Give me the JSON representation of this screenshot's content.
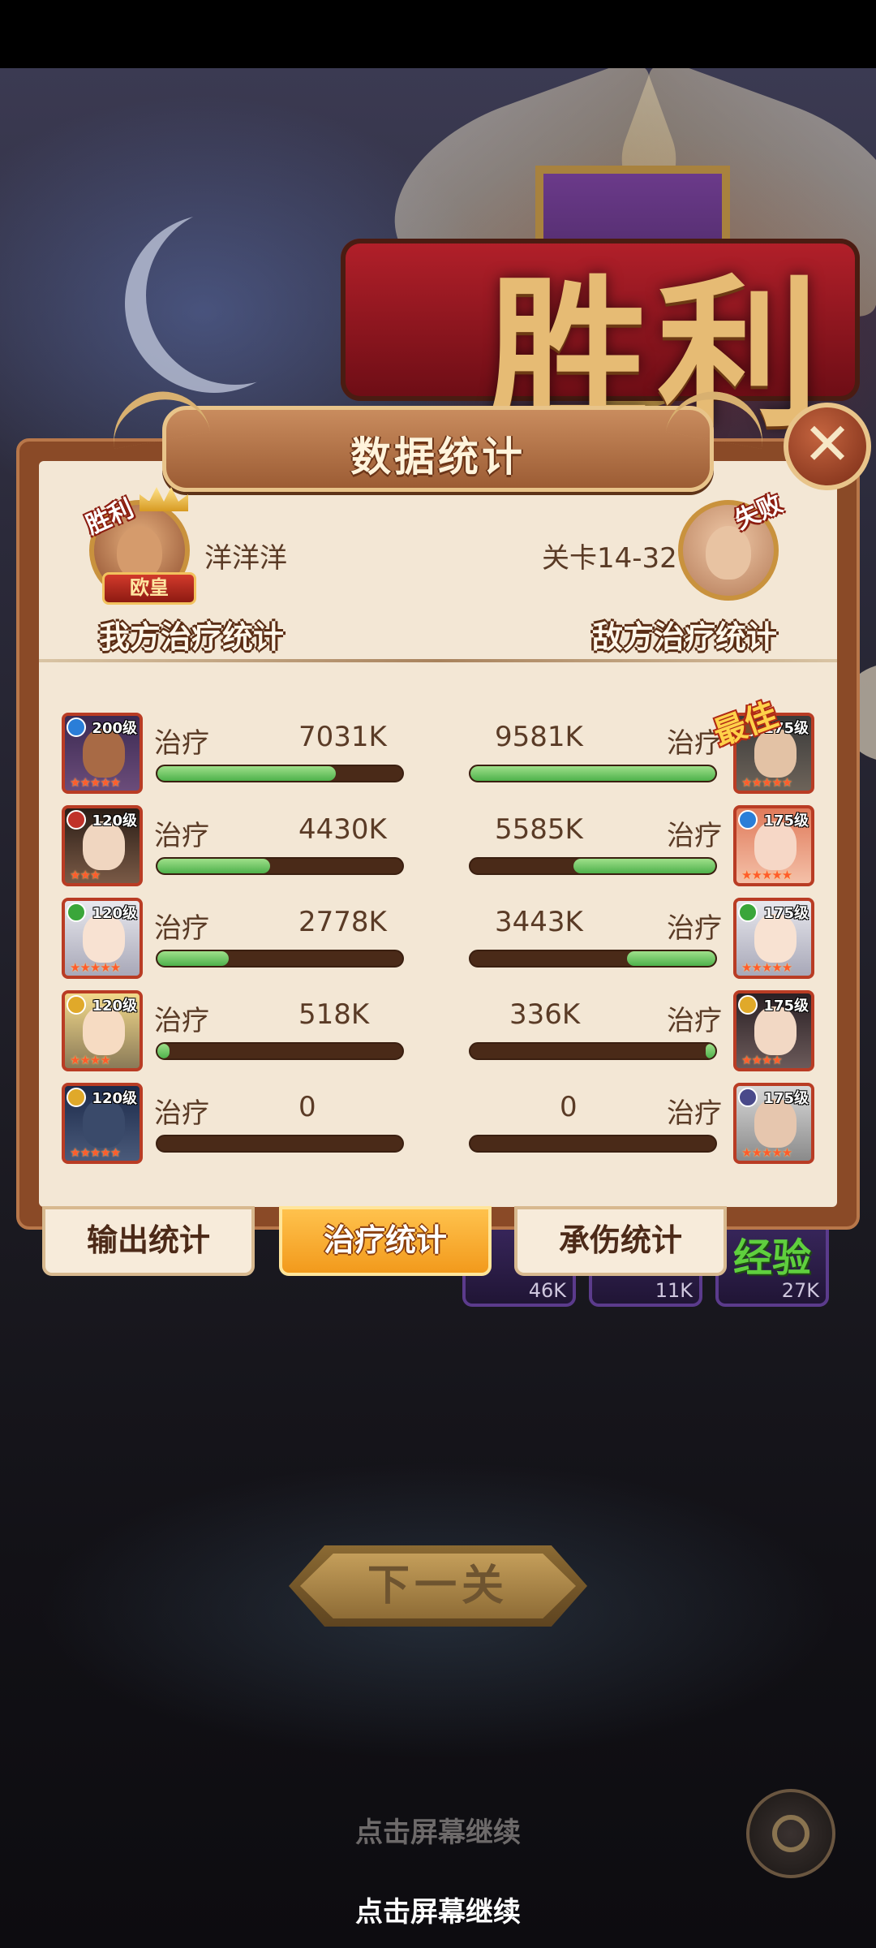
{
  "screen": {
    "victory_text": "胜利",
    "panel_title": "数据统计",
    "close_label": "✕"
  },
  "header": {
    "player": {
      "badge": "胜利",
      "rank": "欧皇",
      "name": "洋洋洋"
    },
    "enemy": {
      "badge": "失败",
      "stage": "关卡14-32"
    },
    "left_section": "我方治疗统计",
    "right_section": "敌方治疗统计",
    "best_tag": "最佳"
  },
  "colors": {
    "bar_fill": "#6cc75a",
    "bar_track": "#4a2a18",
    "panel_bg": "#f3e7d5",
    "frame": "#8a4a27",
    "tab_active": "#f6ae2e"
  },
  "rows": [
    {
      "left": {
        "level": "200级",
        "label": "治疗",
        "value": "7031K",
        "fill": 0.73,
        "stars": "★★★★★",
        "elem_color": "#2a7ed8"
      },
      "right": {
        "level": "175级",
        "label": "治疗",
        "value": "9581K",
        "fill": 1.0,
        "stars": "★★★★★",
        "elem_color": "#7a4c2c"
      }
    },
    {
      "left": {
        "level": "120级",
        "label": "治疗",
        "value": "4430K",
        "fill": 0.46,
        "stars": "★★★",
        "elem_color": "#c0322a"
      },
      "right": {
        "level": "175级",
        "label": "治疗",
        "value": "5585K",
        "fill": 0.58,
        "stars": "★★★★★",
        "elem_color": "#2a7ed8"
      }
    },
    {
      "left": {
        "level": "120级",
        "label": "治疗",
        "value": "2778K",
        "fill": 0.29,
        "stars": "★★★★★",
        "elem_color": "#3aa63a"
      },
      "right": {
        "level": "175级",
        "label": "治疗",
        "value": "3443K",
        "fill": 0.36,
        "stars": "★★★★★",
        "elem_color": "#3aa63a"
      }
    },
    {
      "left": {
        "level": "120级",
        "label": "治疗",
        "value": "518K",
        "fill": 0.05,
        "stars": "★★★★",
        "elem_color": "#e0a92a"
      },
      "right": {
        "level": "175级",
        "label": "治疗",
        "value": "336K",
        "fill": 0.04,
        "stars": "★★★★",
        "elem_color": "#e0a92a"
      }
    },
    {
      "left": {
        "level": "120级",
        "label": "治疗",
        "value": "0",
        "fill": 0,
        "stars": "★★★★★",
        "elem_color": "#e0a92a"
      },
      "right": {
        "level": "175级",
        "label": "治疗",
        "value": "0",
        "fill": 0,
        "stars": "★★★★★",
        "elem_color": "#4a4a8a"
      }
    }
  ],
  "tabs": [
    {
      "label": "输出统计",
      "active": false
    },
    {
      "label": "治疗统计",
      "active": true
    },
    {
      "label": "承伤统计",
      "active": false
    }
  ],
  "rewards": [
    {
      "count": "46K"
    },
    {
      "count": "11K"
    },
    {
      "label": "经验",
      "count": "27K"
    }
  ],
  "next_button": "下一关",
  "hints": [
    "点击屏幕继续",
    "点击屏幕继续"
  ]
}
